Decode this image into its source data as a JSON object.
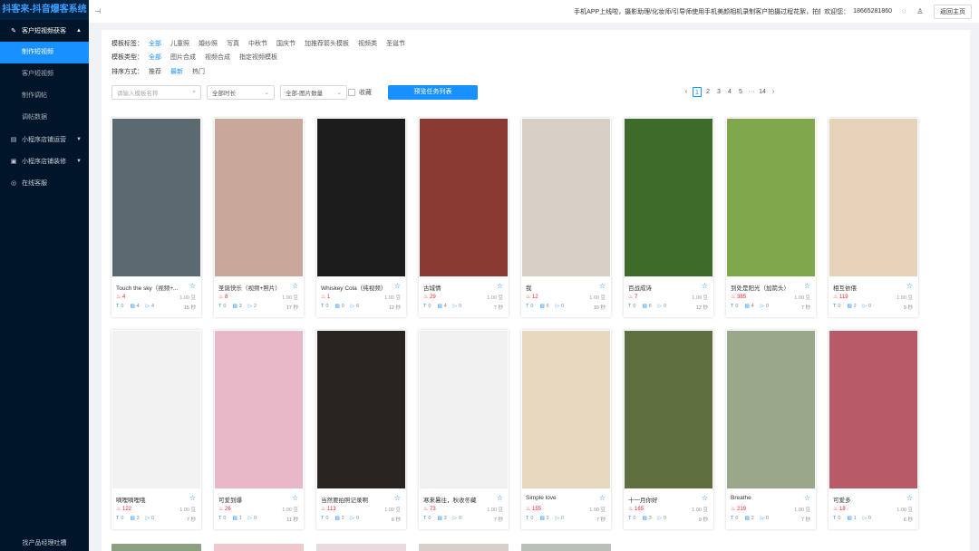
{
  "app": {
    "title": "抖客来-抖音爆客系统"
  },
  "sidebar": {
    "groups": [
      {
        "label": "客户短视频获客",
        "icon": "edit-icon",
        "expanded": true,
        "children": [
          {
            "label": "制作短视频",
            "active": true
          },
          {
            "label": "客户短视频",
            "active": false
          },
          {
            "label": "制作调帖",
            "active": false
          },
          {
            "label": "调帖数据",
            "active": false
          }
        ]
      },
      {
        "label": "小程序店铺运营",
        "icon": "store-icon",
        "expanded": false
      },
      {
        "label": "小程序店铺装修",
        "icon": "decorate-icon",
        "expanded": false
      },
      {
        "label": "在线客服",
        "icon": "service-icon",
        "expanded": false
      }
    ],
    "footer": "找产品经理吐槽"
  },
  "topbar": {
    "marquee": "手机APP上线啦，摄影助理/化妆师/引导师使用手机美颜相机录制客户拍摄过程花絮，拍摄",
    "welcome": "欢迎您：",
    "phone": "18665281860",
    "home_button": "返回主页"
  },
  "filters": {
    "tags": {
      "label": "模板标签：",
      "options": [
        "全部",
        "儿童照",
        "婚纱照",
        "写真",
        "中秋节",
        "国庆节",
        "加推荐箭头模板",
        "视频类",
        "圣诞节"
      ],
      "selected": 0
    },
    "types": {
      "label": "模板类型：",
      "options": [
        "全部",
        "图片合成",
        "视频合成",
        "指定视频模板"
      ],
      "selected": 0
    },
    "sort": {
      "label": "排序方式：",
      "options": [
        "推荐",
        "最新",
        "热门"
      ],
      "selected": 1
    }
  },
  "toolbar": {
    "search_placeholder": "请输入模板名称",
    "duration_select": "全部时长",
    "count_select": "全部-图片数量",
    "favorite_label": "收藏",
    "preview_button": "预览任务列表"
  },
  "pagination": {
    "pages": [
      "1",
      "2",
      "3",
      "4",
      "5",
      "···",
      "14"
    ],
    "current": "1"
  },
  "cards": [
    {
      "title": "Touch the sky（视频+...",
      "heat": "4",
      "price": "1.00 豆",
      "t": "0",
      "img": "4",
      "vid": "4",
      "dur": "15 秒",
      "overlay": ""
    },
    {
      "title": "圣诞快乐（视频+照片）",
      "heat": "8",
      "price": "1.00 豆",
      "t": "0",
      "img": "3",
      "vid": "2",
      "dur": "17 秒",
      "overlay": ""
    },
    {
      "title": "Whiskey Cola（纯视频）",
      "heat": "1",
      "price": "1.00 豆",
      "t": "0",
      "img": "0",
      "vid": "6",
      "dur": "12 秒",
      "overlay": ""
    },
    {
      "title": "古城情",
      "heat": "29",
      "price": "1.00 豆",
      "t": "0",
      "img": "4",
      "vid": "0",
      "dur": "7 秒",
      "overlay": ""
    },
    {
      "title": "我",
      "heat": "12",
      "price": "1.00 豆",
      "t": "0",
      "img": "6",
      "vid": "0",
      "dur": "10 秒",
      "overlay": ""
    },
    {
      "title": "百战成诗",
      "heat": "7",
      "price": "1.00 豆",
      "t": "0",
      "img": "6",
      "vid": "0",
      "dur": "12 秒",
      "overlay": ""
    },
    {
      "title": "到处是阳光（加箭头）",
      "heat": "385",
      "price": "1.00 豆",
      "t": "0",
      "img": "4",
      "vid": "0",
      "dur": "7 秒",
      "overlay": ""
    },
    {
      "title": "相互依偎",
      "heat": "119",
      "price": "1.00 豆",
      "t": "0",
      "img": "2",
      "vid": "0",
      "dur": "9 秒",
      "overlay": ""
    },
    {
      "title": "嘀哩嘀哩哦",
      "heat": "122",
      "price": "1.00 豆",
      "t": "0",
      "img": "3",
      "vid": "0",
      "dur": "7 秒",
      "overlay": ""
    },
    {
      "title": "可爱到爆",
      "heat": "26",
      "price": "1.00 豆",
      "t": "0",
      "img": "1",
      "vid": "0",
      "dur": "11 秒",
      "overlay": ""
    },
    {
      "title": "当然要拍照记录啊",
      "heat": "113",
      "price": "1.00 豆",
      "t": "0",
      "img": "2",
      "vid": "0",
      "dur": "6 秒",
      "overlay": ""
    },
    {
      "title": "寒来暑往，秋收冬藏",
      "heat": "73",
      "price": "1.00 豆",
      "t": "0",
      "img": "3",
      "vid": "0",
      "dur": "7 秒",
      "overlay": ""
    },
    {
      "title": "Simple love",
      "heat": "155",
      "price": "1.00 豆",
      "t": "0",
      "img": "2",
      "vid": "0",
      "dur": "7 秒",
      "overlay": ""
    },
    {
      "title": "十一月你好",
      "heat": "165",
      "price": "1.00 豆",
      "t": "0",
      "img": "3",
      "vid": "0",
      "dur": "9 秒",
      "overlay": ""
    },
    {
      "title": "Breathe",
      "heat": "219",
      "price": "1.00 豆",
      "t": "0",
      "img": "2",
      "vid": "0",
      "dur": "7 秒",
      "overlay": ""
    },
    {
      "title": "可爱多",
      "heat": "18",
      "price": "1.00 豆",
      "t": "0",
      "img": "1",
      "vid": "0",
      "dur": "6 秒",
      "overlay": ""
    }
  ],
  "thumb_colors": [
    "#5a6a70",
    "#c9a79a",
    "#1c1c1c",
    "#8a3a32",
    "#d8cfc6",
    "#3d6b2a",
    "#7fa84c",
    "#e6d2b8",
    "#f2f2f2",
    "#e8b8c8",
    "#2a2420",
    "#f0f0f0",
    "#e8d8c0",
    "#5e7040",
    "#9aa88a",
    "#b85a68"
  ],
  "partial_colors": [
    "#8aa080",
    "#f0c8cc",
    "#e8d8e0",
    "#d8d0c8",
    "#b8c0b8"
  ]
}
